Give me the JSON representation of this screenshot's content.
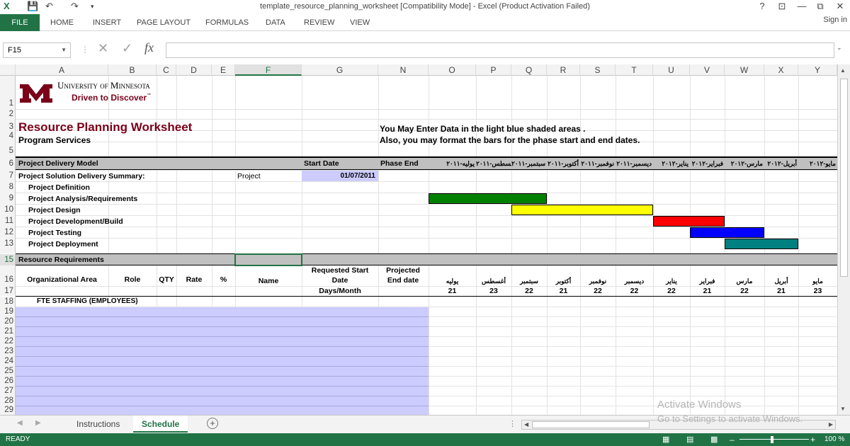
{
  "window": {
    "title": "template_resource_planning_worksheet  [Compatibility Mode] - Excel (Product Activation Failed)",
    "buttons": [
      "?",
      "⊡",
      "—",
      "⧉",
      "✕"
    ]
  },
  "ribbon": {
    "file": "FILE",
    "tabs": [
      "HOME",
      "INSERT",
      "PAGE LAYOUT",
      "FORMULAS",
      "DATA",
      "REVIEW",
      "VIEW"
    ],
    "signin": "Sign in"
  },
  "formula_bar": {
    "namebox": "F15",
    "fx": "fx",
    "value": ""
  },
  "columns": [
    "A",
    "B",
    "C",
    "D",
    "E",
    "F",
    "G",
    "N",
    "O",
    "P",
    "Q",
    "R",
    "S",
    "T",
    "U",
    "V",
    "W",
    "X",
    "Y"
  ],
  "row_numbers": [
    "1",
    "2",
    "3",
    "4",
    "5",
    "6",
    "7",
    "8",
    "9",
    "10",
    "11",
    "12",
    "13",
    "15",
    "16",
    "17",
    "18",
    "19",
    "20",
    "21",
    "22",
    "23",
    "24",
    "25",
    "26",
    "27",
    "28",
    "29"
  ],
  "logo": {
    "line1": "University of Minnesota",
    "line2": "Driven to Discover",
    "tm": "℠"
  },
  "sheet": {
    "title": "Resource Planning Worksheet",
    "subtitle": "Program Services",
    "note1": "You May Enter Data in the light blue shaded areas .",
    "note2": "Also, you may format the bars for the phase start and end dates.",
    "pdm": "Project Delivery Model",
    "start_date_hdr": "Start Date",
    "phase_end_hdr": "Phase End",
    "month_headers": [
      "يوليه-٢٠١١",
      "أغسطس-٢٠١١",
      "سبتمبر-٢٠١١",
      "أكتوبر-٢٠١١",
      "نوفمبر-٢٠١١",
      "ديسمبر-٢٠١١",
      "يناير-٢٠١٢",
      "فبراير-٢٠١٢",
      "مارس-٢٠١٢",
      "أبريل-٢٠١٢",
      "مايو-٢٠١٢"
    ],
    "summary": "Project Solution Delivery Summary:",
    "project": "Project",
    "start_date": "01/07/2011",
    "phases": [
      "Project Definition",
      "Project Analysis/Requirements",
      "Project Design",
      "Project Development/Build",
      "Project Testing",
      "Project Deployment"
    ],
    "resource_req": "Resource Requirements",
    "hdr": {
      "org": "Organizational Area",
      "role": "Role",
      "qty": "QTY",
      "rate": "Rate",
      "pct": "%",
      "name": "Name",
      "req_start": "Requested Start Date",
      "proj_end": "Projected End date",
      "days": "Days/Month"
    },
    "month_short": [
      "يوليه",
      "أغسطس",
      "سبتمبر",
      "أكتوبر",
      "نوفمبر",
      "ديسمبر",
      "يناير",
      "فبراير",
      "مارس",
      "أبريل",
      "مايو"
    ],
    "days": [
      "21",
      "23",
      "22",
      "21",
      "22",
      "22",
      "22",
      "21",
      "22",
      "21",
      "23"
    ],
    "fte": "FTE STAFFING (EMPLOYEES)"
  },
  "gantt": [
    {
      "phase": "Project Analysis/Requirements",
      "start": "يوليه-٢٠١١",
      "end": "سبتمبر-٢٠١١",
      "color": "#008000"
    },
    {
      "phase": "Project Design",
      "start": "سبتمبر-٢٠١١",
      "end": "ديسمبر-٢٠١١",
      "color": "#ffff00"
    },
    {
      "phase": "Project Development/Build",
      "start": "يناير-٢٠١٢",
      "end": "فبراير-٢٠١٢",
      "color": "#ff0000"
    },
    {
      "phase": "Project Testing",
      "start": "فبراير-٢٠١٢",
      "end": "مارس-٢٠١٢",
      "color": "#0000ff"
    },
    {
      "phase": "Project Deployment",
      "start": "مارس-٢٠١٢",
      "end": "أبريل-٢٠١٢",
      "color": "#008080"
    }
  ],
  "sheets": [
    "Instructions",
    "Schedule"
  ],
  "status": {
    "ready": "READY",
    "zoom": "100 %"
  },
  "watermark": {
    "line1": "Activate Windows",
    "line2": "Go to Settings to activate Windows."
  },
  "colors": {
    "excel_green": "#217346",
    "brand_maroon": "#7a0019",
    "brand_gold": "#ffcc33",
    "input_fill": "#ccccff",
    "header_fill": "#c0c0c0"
  }
}
